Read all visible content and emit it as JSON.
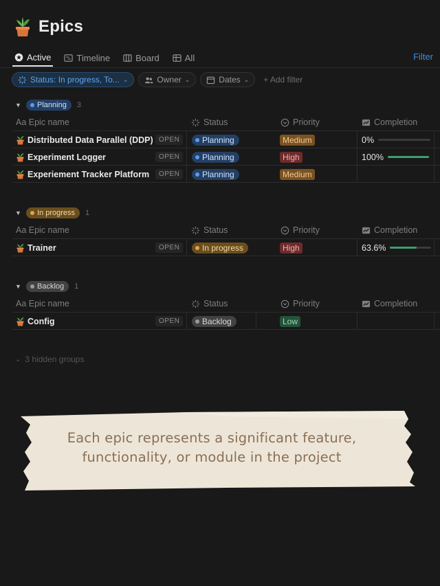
{
  "page": {
    "title": "Epics",
    "icon": "potted-plant-icon"
  },
  "tabs": [
    {
      "label": "Active",
      "icon": "star-circle-icon",
      "active": true
    },
    {
      "label": "Timeline",
      "icon": "timeline-icon",
      "active": false
    },
    {
      "label": "Board",
      "icon": "board-icon",
      "active": false
    },
    {
      "label": "All",
      "icon": "table-icon",
      "active": false
    }
  ],
  "toolbar": {
    "filter_label": "Filter"
  },
  "filters": {
    "status_chip": "Status: In progress, To...",
    "owner_chip": "Owner",
    "dates_chip": "Dates",
    "add_filter": "+ Add filter"
  },
  "columns": {
    "name": "Aa Epic name",
    "status": "Status",
    "priority": "Priority",
    "completion": "Completion"
  },
  "groups": [
    {
      "label": "Planning",
      "count": "3",
      "color": "#2d5a9e",
      "dot": "#5b9bf0",
      "rows": [
        {
          "name": "Distributed Data Parallel (DDP)",
          "open": "OPEN",
          "status": "Planning",
          "priority": "Medium",
          "completion": "0%",
          "completion_value": 0
        },
        {
          "name": "Experiment Logger",
          "open": "OPEN",
          "status": "Planning",
          "priority": "High",
          "completion": "100%",
          "completion_value": 1.0
        },
        {
          "name": "Experiement Tracker Platform",
          "open": "OPEN",
          "status": "Planning",
          "priority": "Medium",
          "completion": "",
          "completion_value": null
        }
      ]
    },
    {
      "label": "In progress",
      "count": "1",
      "color": "#7a5a22",
      "dot": "#e0a54a",
      "rows": [
        {
          "name": "Trainer",
          "open": "OPEN",
          "status": "In progress",
          "priority": "High",
          "completion": "63.6%",
          "completion_value": 0.636
        }
      ]
    },
    {
      "label": "Backlog",
      "count": "1",
      "color": "#4a4a4a",
      "dot": "#9b9b9b",
      "rows": [
        {
          "name": "Config",
          "open": "OPEN",
          "status": "Backlog",
          "priority": "Low",
          "completion": "",
          "completion_value": null
        }
      ]
    }
  ],
  "hidden_groups": "3 hidden groups",
  "caption": {
    "line1": "Each epic represents a significant feature,",
    "line2": "functionality, or module in the project"
  },
  "colors": {
    "accent": "#3a8ee6",
    "priority_medium_bg": "#7a5220",
    "priority_medium_fg": "#f0c99a",
    "priority_high_bg": "#6e2b2b",
    "priority_high_fg": "#f0b0b0",
    "priority_low_bg": "#24533a",
    "priority_low_fg": "#9fd9b6",
    "progress_fill": "#3f9d73",
    "tape": "#ede6d8",
    "caption_text": "#8a6f56"
  }
}
